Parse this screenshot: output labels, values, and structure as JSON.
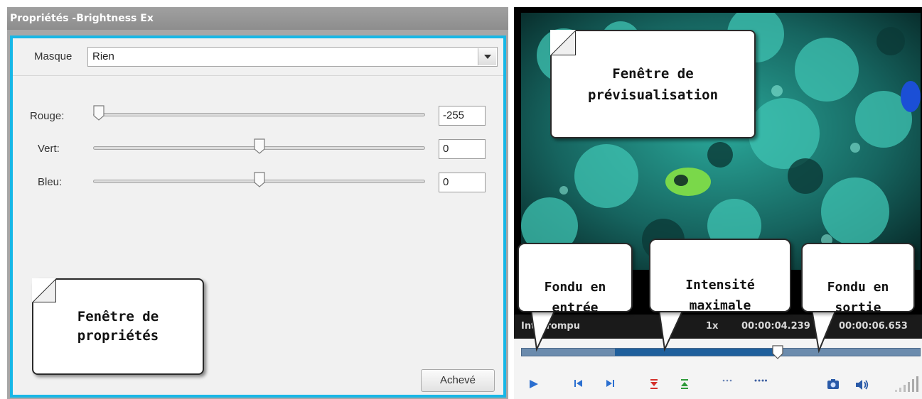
{
  "properties_panel": {
    "title": "Propriétés -Brightness Ex",
    "mask_label": "Masque",
    "mask_value": "Rien",
    "sliders": [
      {
        "label": "Rouge:",
        "value": "-255",
        "level": 0.0
      },
      {
        "label": "Vert:",
        "value": "0",
        "level": 0.5
      },
      {
        "label": "Bleu:",
        "value": "0",
        "level": 0.5
      }
    ],
    "done_button": "Achevé"
  },
  "callouts": {
    "properties_window": "Fenêtre de\npropriétés",
    "preview_window": "Fenêtre de\nprévisualisation",
    "fade_in": "Fondu en\nentrée",
    "max_intensity": "Intensité\nmaximale",
    "fade_out": "Fondu en\nsortie"
  },
  "preview": {
    "status": "Interrompu",
    "speed": "1x",
    "current_time": "00:00:04.239",
    "total_time": "00:00:06.653",
    "icons": [
      "play-icon",
      "previous-frame-icon",
      "next-frame-icon",
      "set-in-marker-icon",
      "set-out-marker-icon",
      "dots-icon",
      "dots-long-icon",
      "snapshot-icon",
      "volume-icon"
    ]
  },
  "colors": {
    "accent": "#18b7e6",
    "title_bar": "#9a9a9a",
    "timeline_fill": "#1f5f9c",
    "play": "#2b6fd0",
    "marker_red": "#d4302a",
    "marker_green": "#2f9a3a"
  }
}
